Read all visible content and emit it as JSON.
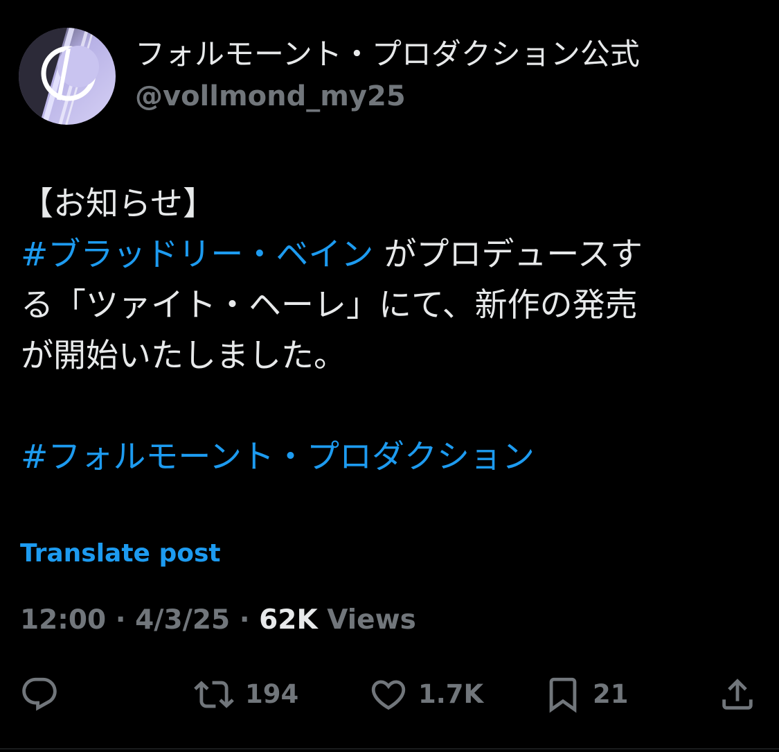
{
  "author": {
    "display_name": "フォルモーント・プロダクション公式",
    "handle": "@vollmond_my25",
    "avatar_icon": "crescent-moon-logo-icon"
  },
  "post": {
    "line1": "【お知らせ】",
    "hashtag1": "#ブラッドリー・ベイン",
    "line2_rest": " がプロデュースす",
    "line3": "る「ツァイト・ヘーレ」にて、新作の発売",
    "line4": "が開始いたしました。",
    "hashtag2": "#フォルモーント・プロダクション"
  },
  "translate_label": "Translate post",
  "meta": {
    "time": "12:00",
    "sep1": " · ",
    "date": "4/3/25",
    "sep2": " · ",
    "views_count": "62K",
    "views_label": " Views"
  },
  "actions": {
    "reply": {
      "icon": "reply-icon",
      "count": ""
    },
    "repost": {
      "icon": "repost-icon",
      "count": "194"
    },
    "like": {
      "icon": "heart-icon",
      "count": "1.7K"
    },
    "bookmark": {
      "icon": "bookmark-icon",
      "count": "21"
    },
    "share": {
      "icon": "share-icon",
      "count": ""
    }
  },
  "colors": {
    "background": "#000000",
    "text": "#e7e9ea",
    "secondary": "#71767b",
    "link": "#1d9bf0",
    "avatar_bg": "#cfcaf2"
  }
}
